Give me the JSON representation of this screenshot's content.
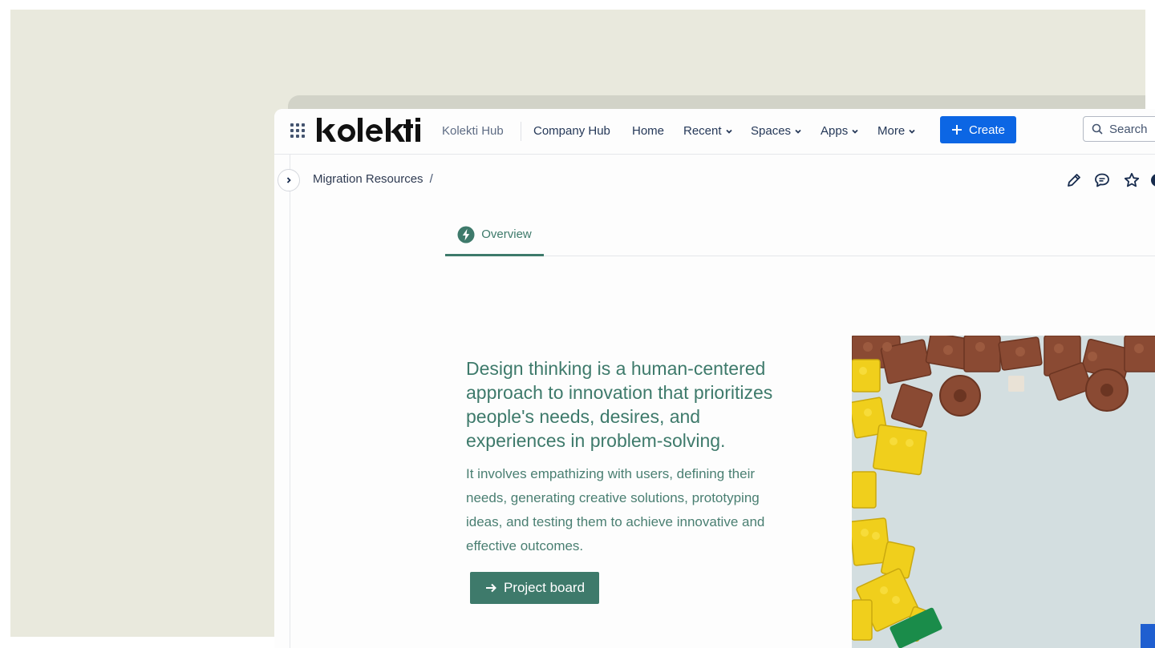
{
  "app": {
    "hub_name": "Kolekti Hub",
    "accent_color": "#0c66e4",
    "brand_color": "#3e7a6b",
    "logo_icon": "kolekti-logo"
  },
  "nav": {
    "items": [
      {
        "label": "Company Hub",
        "dropdown": false
      },
      {
        "label": "Home",
        "dropdown": false
      },
      {
        "label": "Recent",
        "dropdown": true
      },
      {
        "label": "Spaces",
        "dropdown": true
      },
      {
        "label": "Apps",
        "dropdown": true
      },
      {
        "label": "More",
        "dropdown": true
      }
    ],
    "create_label": "Create",
    "search_label": "Search"
  },
  "breadcrumb": {
    "items": [
      "Migration Resources"
    ],
    "separator": "/"
  },
  "page_actions": [
    "edit-icon",
    "comment-icon",
    "star-icon",
    "more-icon"
  ],
  "tabs": [
    {
      "label": "Overview",
      "icon": "lightning-icon",
      "active": true
    }
  ],
  "hero": {
    "headline": "Design thinking is a human-centered approach to innovation that prioritizes people's needs, desires, and experiences in problem-solving.",
    "body": "It involves empathizing with users, defining their needs, generating creative solutions, prototyping ideas, and testing them to achieve innovative and effective outcomes.",
    "cta_label": "Project board",
    "image": "lego-bricks-photo"
  }
}
